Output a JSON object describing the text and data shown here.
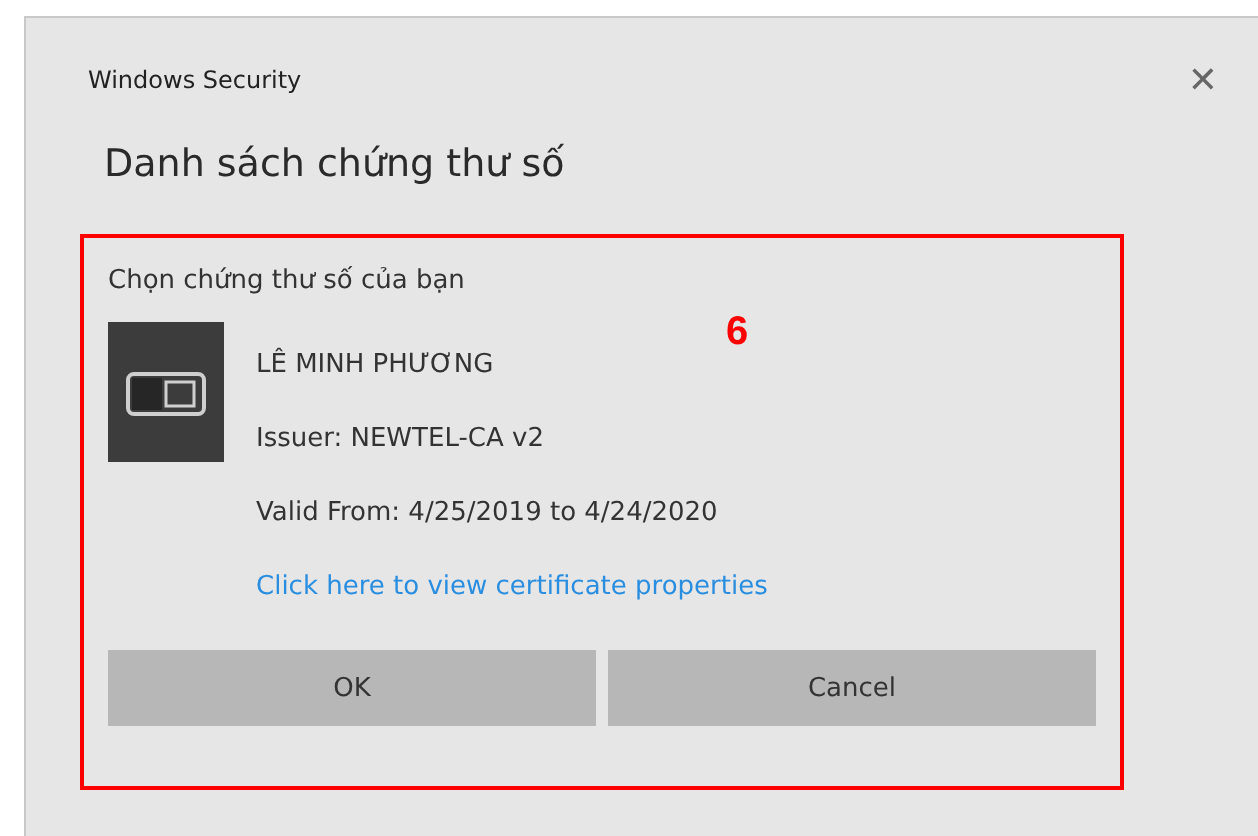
{
  "window": {
    "title": "Windows Security",
    "close_glyph": "✕"
  },
  "heading": "Danh sách chứng thư số",
  "annotation": {
    "label": "6"
  },
  "prompt": "Chọn chứng thư số của bạn",
  "certificate": {
    "name": "LÊ MINH PHƯƠNG",
    "issuer": "Issuer: NEWTEL-CA v2",
    "validity": "Valid From: 4/25/2019 to 4/24/2020",
    "link": "Click here to view certificate properties"
  },
  "buttons": [
    "OK",
    "Cancel"
  ]
}
